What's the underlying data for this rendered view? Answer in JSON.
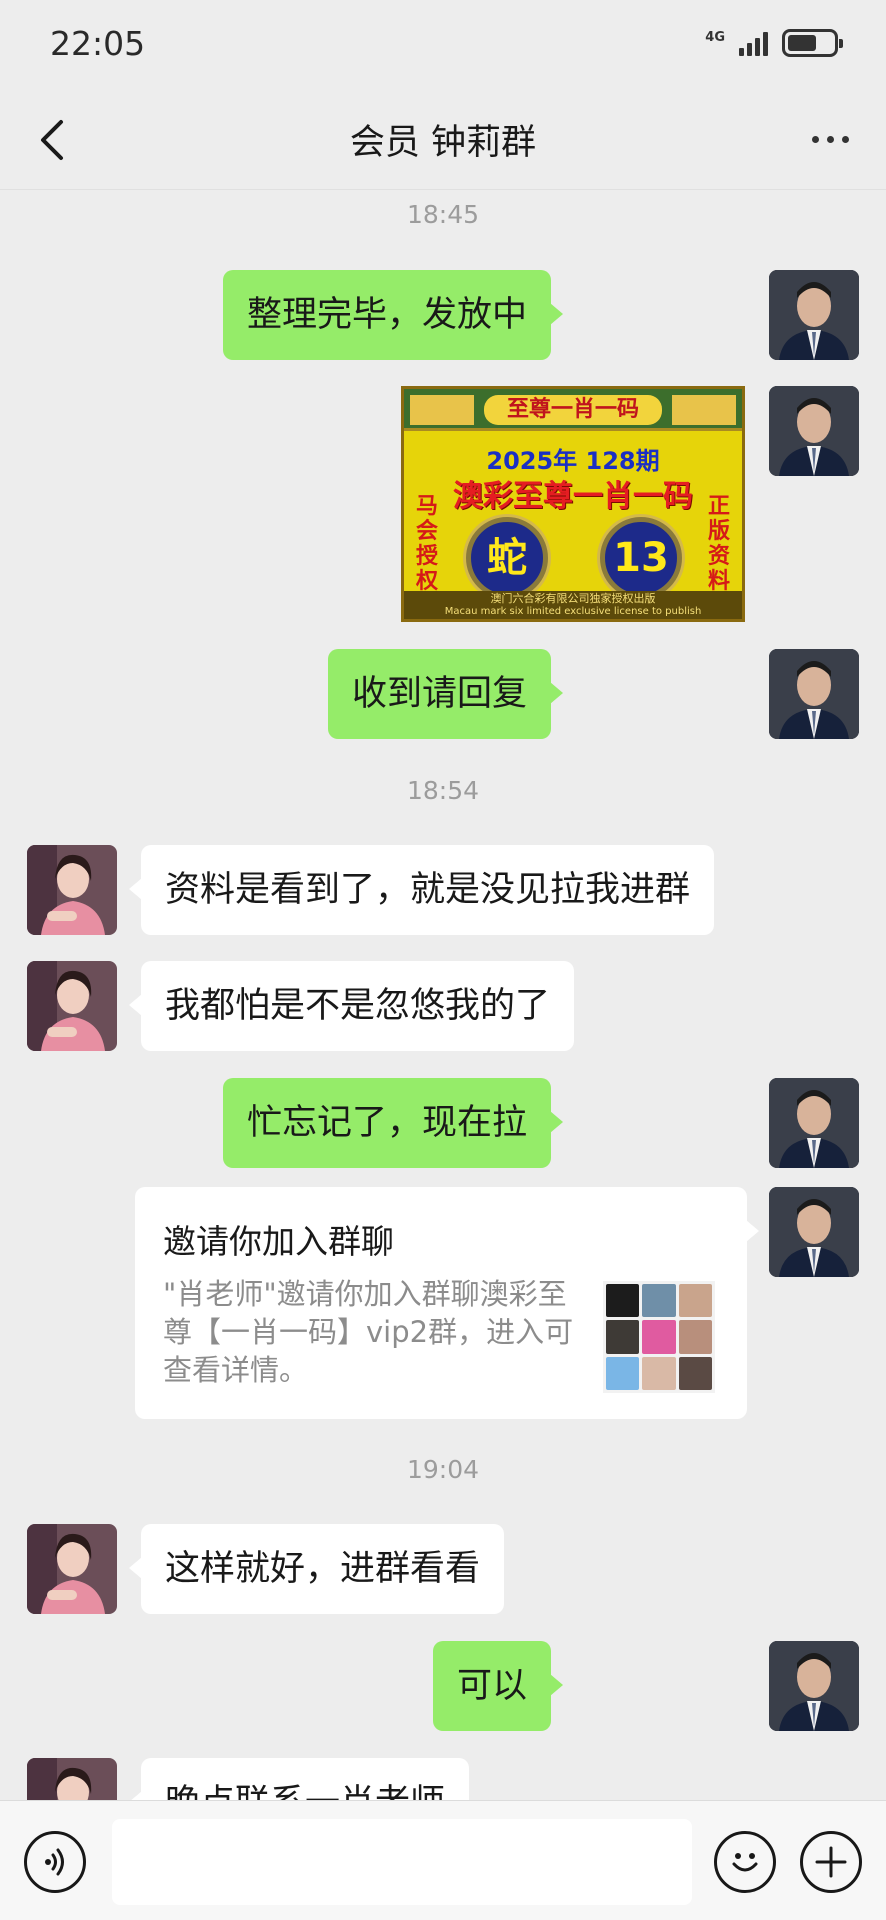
{
  "status_bar": {
    "time": "22:05",
    "network": "4G"
  },
  "header": {
    "title": "会员 钟莉群"
  },
  "messages": {
    "t1": "18:45",
    "m1": "整理完毕，发放中",
    "image": {
      "top_title": "至尊一肖一码",
      "year_issue": "2025年  128期",
      "brand": "澳彩至尊一肖一码",
      "left_side": "马会授权",
      "right_side": "正版资料",
      "zodiac": "蛇",
      "number": "13",
      "footer_cn": "澳门六合彩有限公司独家授权出版",
      "footer_en": "Macau mark six limited exclusive license to publish"
    },
    "m2": "收到请回复",
    "t2": "18:54",
    "m3": "资料是看到了，就是没见拉我进群",
    "m4": "我都怕是不是忽悠我的了",
    "m5": "忙忘记了，现在拉",
    "invite": {
      "title": "邀请你加入群聊",
      "desc": "\"肖老师\"邀请你加入群聊澳彩至尊【一肖一码】vip2群，进入可查看详情。"
    },
    "t3": "19:04",
    "m6": "这样就好，进群看看",
    "m7": "可以",
    "m8": "晚点联系一肖老师"
  },
  "colors": {
    "background": "#ededed",
    "sent_bubble": "#95ec69",
    "received_bubble": "#ffffff",
    "timestamp": "#9c9c9c"
  },
  "icons": {
    "back": "chevron-left-icon",
    "more": "more-dots-icon",
    "voice": "voice-icon",
    "emoji": "emoji-icon",
    "plus": "plus-icon"
  }
}
